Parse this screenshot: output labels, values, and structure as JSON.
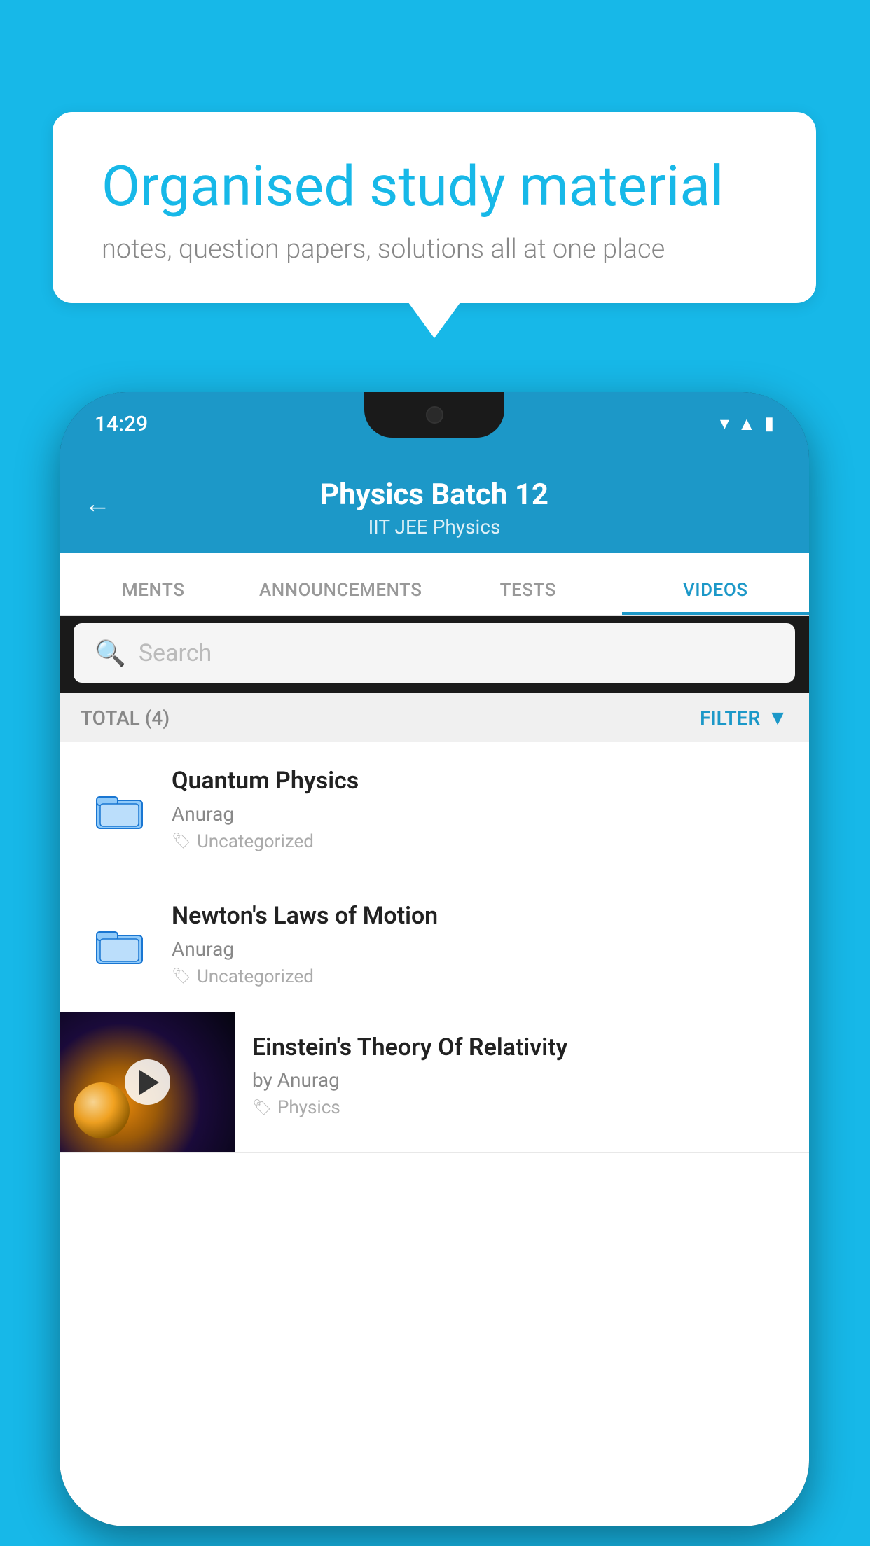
{
  "background": {
    "color": "#17b8e8"
  },
  "bubble": {
    "title": "Organised study material",
    "subtitle": "notes, question papers, solutions all at one place"
  },
  "phone": {
    "status_time": "14:29",
    "header": {
      "title": "Physics Batch 12",
      "subtitle": "IIT JEE   Physics",
      "back_label": "←"
    },
    "tabs": [
      {
        "label": "MENTS",
        "active": false
      },
      {
        "label": "ANNOUNCEMENTS",
        "active": false
      },
      {
        "label": "TESTS",
        "active": false
      },
      {
        "label": "VIDEOS",
        "active": true
      }
    ],
    "search": {
      "placeholder": "Search"
    },
    "filter": {
      "total_label": "TOTAL (4)",
      "filter_label": "FILTER"
    },
    "videos": [
      {
        "id": 1,
        "title": "Quantum Physics",
        "author": "Anurag",
        "tag": "Uncategorized",
        "has_thumb": false
      },
      {
        "id": 2,
        "title": "Newton's Laws of Motion",
        "author": "Anurag",
        "tag": "Uncategorized",
        "has_thumb": false
      },
      {
        "id": 3,
        "title": "Einstein's Theory Of Relativity",
        "author": "by Anurag",
        "tag": "Physics",
        "has_thumb": true
      }
    ]
  }
}
